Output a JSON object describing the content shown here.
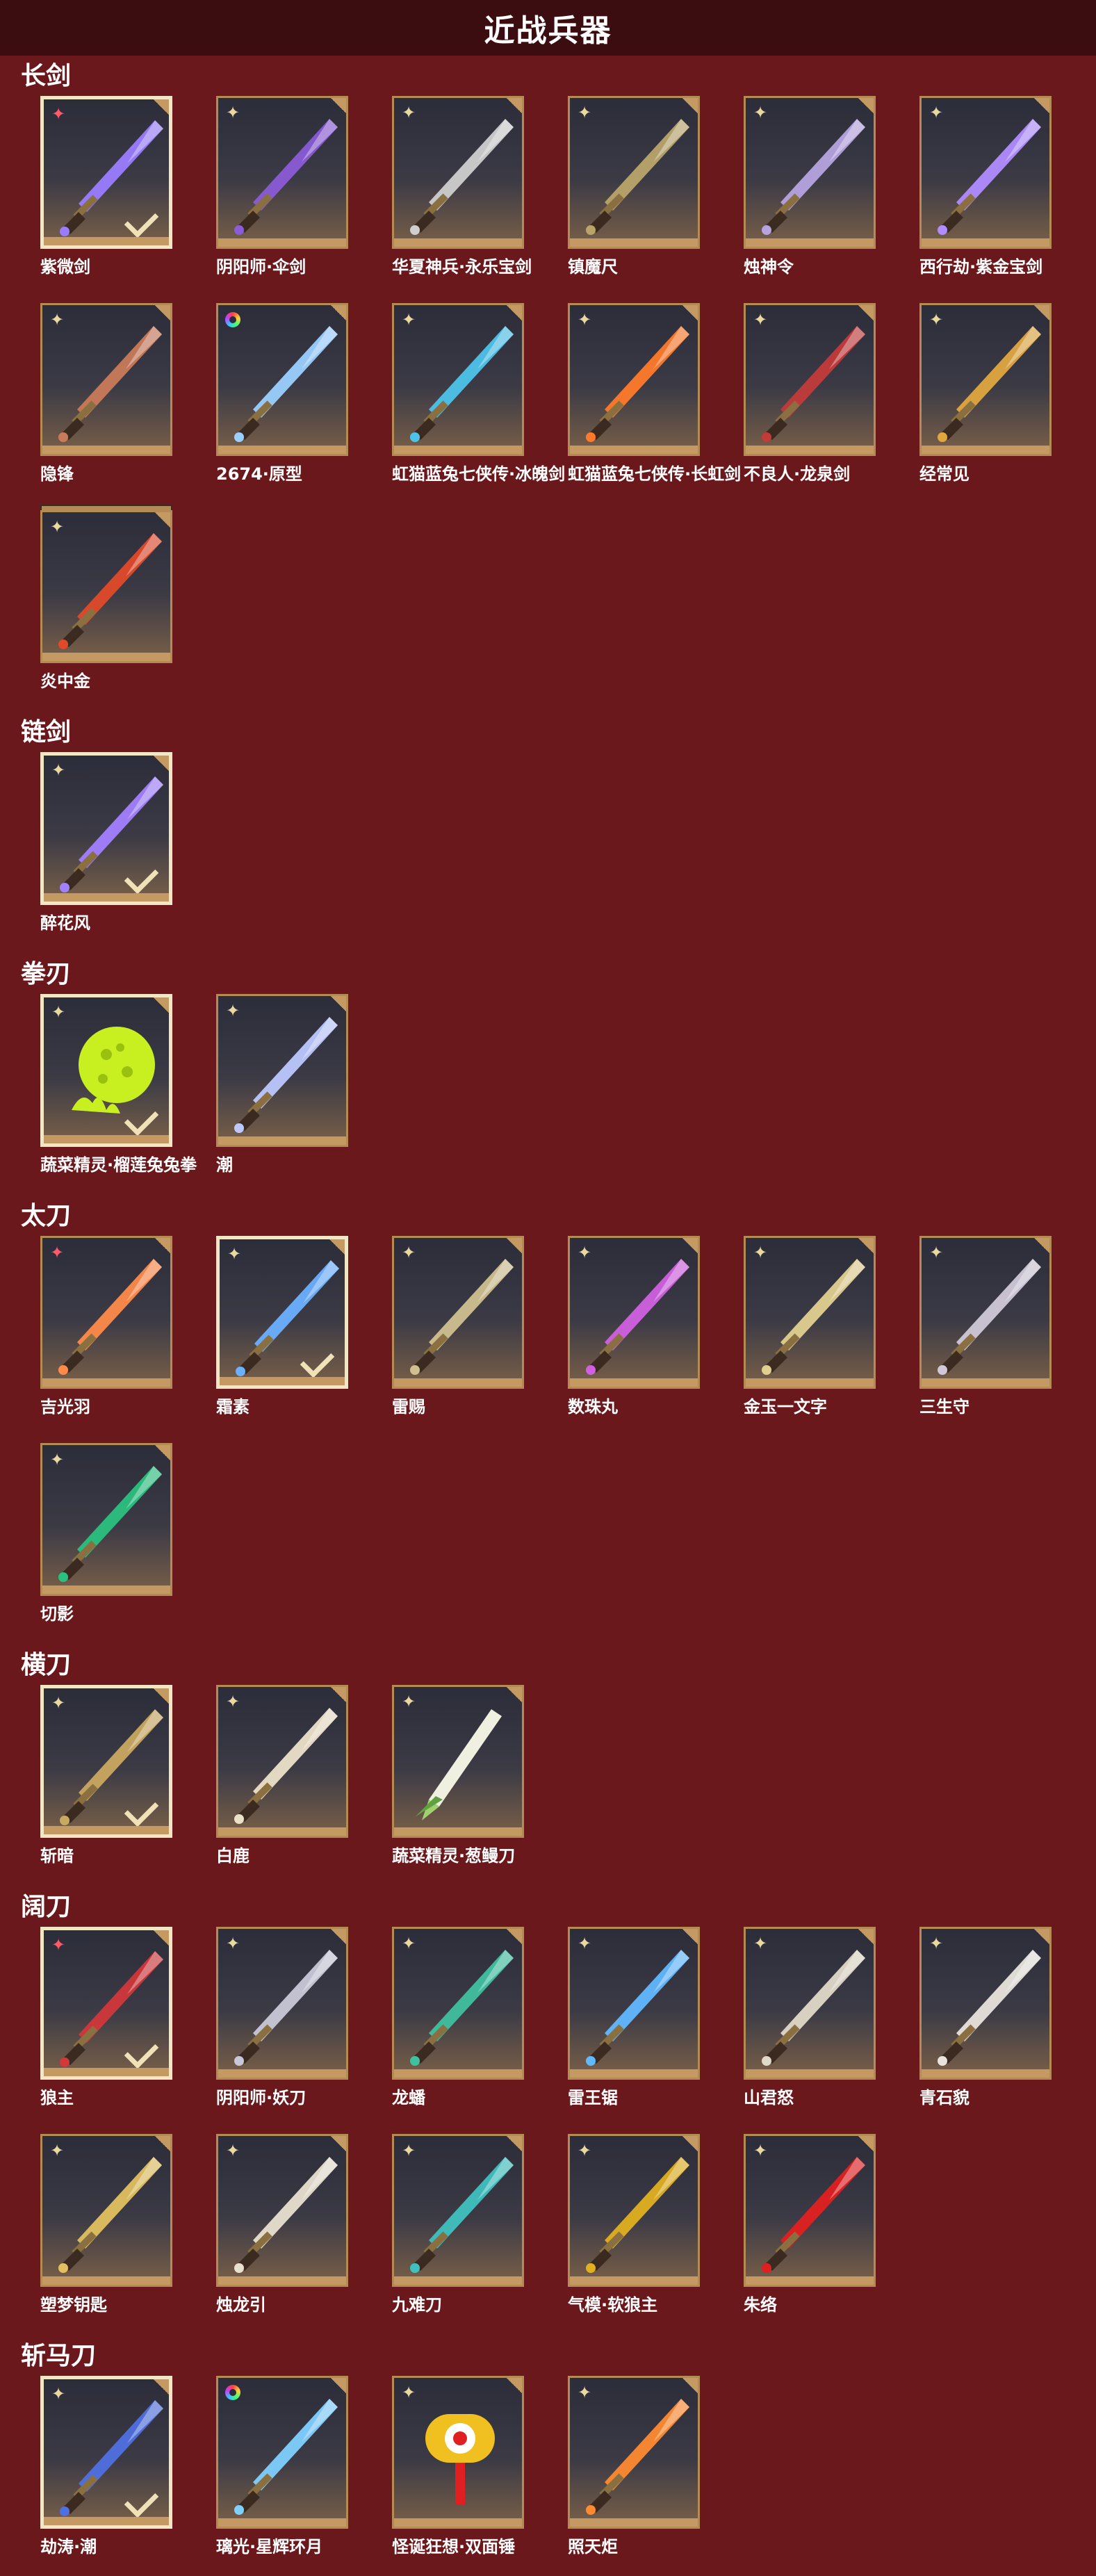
{
  "page": {
    "title": "近战兵器"
  },
  "colors": {
    "background": "#6b181c",
    "title_bar": "#3b0d10",
    "slot_border": "#b48a55",
    "equipped_border": "#f3e6c4",
    "rarity_gold": "#e9d9a0",
    "rarity_red": "#ff5a6a"
  },
  "categories": [
    {
      "label": "长剑",
      "items": [
        {
          "name": "紫微剑",
          "rarity": "red",
          "equipped": true,
          "color": "#9a7cff",
          "icon": "sword-icon"
        },
        {
          "name": "阴阳师·伞剑",
          "rarity": "gold",
          "equipped": false,
          "color": "#8a5cd6",
          "icon": "umbrella-sword-icon"
        },
        {
          "name": "华夏神兵·永乐宝剑",
          "rarity": "gold",
          "equipped": false,
          "color": "#cfcfcf",
          "icon": "sword-icon"
        },
        {
          "name": "镇魔尺",
          "rarity": "gold",
          "equipped": false,
          "color": "#b9a46a",
          "icon": "sword-icon"
        },
        {
          "name": "烛神令",
          "rarity": "gold",
          "equipped": false,
          "color": "#b6a3e0",
          "icon": "sword-icon"
        },
        {
          "name": "西行劫·紫金宝剑",
          "rarity": "gold",
          "equipped": false,
          "color": "#b08cff",
          "icon": "sword-icon"
        },
        {
          "name": "隐锋",
          "rarity": "gold",
          "equipped": false,
          "color": "#c97a5a",
          "icon": "sword-icon"
        },
        {
          "name": "2674·原型",
          "rarity": "rainbow",
          "equipped": false,
          "color": "#9ad0ff",
          "icon": "sword-icon"
        },
        {
          "name": "虹猫蓝兔七侠传·冰魄剑",
          "rarity": "gold",
          "equipped": false,
          "color": "#4ec3ea",
          "icon": "sword-icon"
        },
        {
          "name": "虹猫蓝兔七侠传·长虹剑",
          "rarity": "gold",
          "equipped": false,
          "color": "#ff7a2a",
          "icon": "sword-icon"
        },
        {
          "name": "不良人·龙泉剑",
          "rarity": "gold",
          "equipped": false,
          "color": "#c23a3a",
          "icon": "sword-icon"
        },
        {
          "name": "经常见",
          "rarity": "gold",
          "equipped": false,
          "color": "#e0a740",
          "icon": "sword-icon"
        },
        {
          "name": "炎中金",
          "rarity": "gold",
          "equipped": false,
          "color": "#e04a2a",
          "icon": "sword-icon",
          "stack": true
        }
      ]
    },
    {
      "label": "链剑",
      "items": [
        {
          "name": "醉花风",
          "rarity": "gold",
          "equipped": true,
          "color": "#a280ff",
          "icon": "chain-sword-icon"
        }
      ]
    },
    {
      "label": "拳刃",
      "items": [
        {
          "name": "蔬菜精灵·榴莲兔兔拳",
          "rarity": "gold",
          "equipped": true,
          "color": "#c8f020",
          "icon": "durian-fist-icon"
        },
        {
          "name": "潮",
          "rarity": "gold",
          "equipped": false,
          "color": "#bcc8ff",
          "icon": "claw-icon"
        }
      ]
    },
    {
      "label": "太刀",
      "items": [
        {
          "name": "吉光羽",
          "rarity": "red",
          "equipped": false,
          "color": "#ff8a4a",
          "icon": "katana-icon"
        },
        {
          "name": "霜素",
          "rarity": "gold",
          "equipped": true,
          "color": "#6ab0ff",
          "icon": "katana-icon"
        },
        {
          "name": "雷赐",
          "rarity": "gold",
          "equipped": false,
          "color": "#d0c090",
          "icon": "katana-icon"
        },
        {
          "name": "数珠丸",
          "rarity": "gold",
          "equipped": false,
          "color": "#d060e0",
          "icon": "katana-icon"
        },
        {
          "name": "金玉一文字",
          "rarity": "gold",
          "equipped": false,
          "color": "#e0d090",
          "icon": "katana-icon"
        },
        {
          "name": "三生守",
          "rarity": "gold",
          "equipped": false,
          "color": "#d0c8d8",
          "icon": "katana-icon"
        },
        {
          "name": "切影",
          "rarity": "gold",
          "equipped": false,
          "color": "#2ac080",
          "icon": "katana-icon"
        }
      ]
    },
    {
      "label": "横刀",
      "items": [
        {
          "name": "斩暗",
          "rarity": "gold",
          "equipped": true,
          "color": "#c9a860",
          "icon": "hengdao-icon"
        },
        {
          "name": "白鹿",
          "rarity": "gold",
          "equipped": false,
          "color": "#ece0c8",
          "icon": "hengdao-icon"
        },
        {
          "name": "蔬菜精灵·葱鳗刀",
          "rarity": "gold",
          "equipped": false,
          "color": "#a0d070",
          "icon": "scallion-blade-icon"
        }
      ]
    },
    {
      "label": "阔刀",
      "items": [
        {
          "name": "狼主",
          "rarity": "red",
          "equipped": true,
          "color": "#d0383a",
          "icon": "greatblade-icon"
        },
        {
          "name": "阴阳师·妖刀",
          "rarity": "gold",
          "equipped": false,
          "color": "#c8c8d8",
          "icon": "greatblade-icon"
        },
        {
          "name": "龙蟠",
          "rarity": "gold",
          "equipped": false,
          "color": "#40c0a0",
          "icon": "greatblade-icon"
        },
        {
          "name": "雷王锯",
          "rarity": "gold",
          "equipped": false,
          "color": "#60b8ff",
          "icon": "greatblade-icon"
        },
        {
          "name": "山君怒",
          "rarity": "gold",
          "equipped": false,
          "color": "#e0d8c8",
          "icon": "greatblade-icon"
        },
        {
          "name": "青石貌",
          "rarity": "gold",
          "equipped": false,
          "color": "#e8e4dc",
          "icon": "greatblade-icon"
        },
        {
          "name": "塑梦钥匙",
          "rarity": "gold",
          "equipped": false,
          "color": "#e0c060",
          "icon": "greatblade-icon"
        },
        {
          "name": "烛龙引",
          "rarity": "gold",
          "equipped": false,
          "color": "#e8e0d0",
          "icon": "greatblade-icon"
        },
        {
          "name": "九难刀",
          "rarity": "gold",
          "equipped": false,
          "color": "#40c0c0",
          "icon": "greatblade-icon"
        },
        {
          "name": "气模·软狼主",
          "rarity": "gold",
          "equipped": false,
          "color": "#e0b020",
          "icon": "greatblade-icon"
        },
        {
          "name": "朱络",
          "rarity": "gold",
          "equipped": false,
          "color": "#e02020",
          "icon": "greatblade-icon"
        }
      ]
    },
    {
      "label": "斩马刀",
      "items": [
        {
          "name": "劫涛·潮",
          "rarity": "gold",
          "equipped": true,
          "color": "#5070e0",
          "icon": "zhanma-blade-icon"
        },
        {
          "name": "璃光·星辉环月",
          "rarity": "rainbow",
          "equipped": false,
          "color": "#80d0ff",
          "icon": "zhanma-blade-icon"
        },
        {
          "name": "怪诞狂想·双面锤",
          "rarity": "gold",
          "equipped": false,
          "color": "#f0c020",
          "icon": "hammer-icon"
        },
        {
          "name": "照天炬",
          "rarity": "gold",
          "equipped": false,
          "color": "#ff8a30",
          "icon": "zhanma-blade-icon"
        }
      ]
    }
  ]
}
